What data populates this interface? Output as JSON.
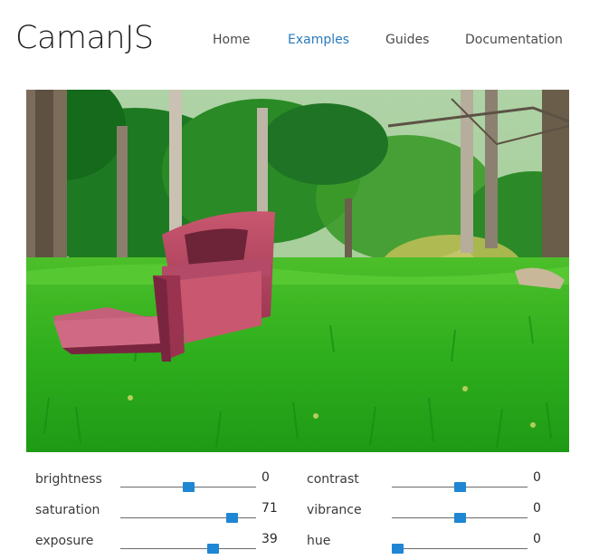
{
  "header": {
    "logo": "CamanJS",
    "nav": [
      {
        "label": "Home",
        "active": false
      },
      {
        "label": "Examples",
        "active": true
      },
      {
        "label": "Guides",
        "active": false
      },
      {
        "label": "Documentation",
        "active": false
      }
    ]
  },
  "colors": {
    "accent": "#2b7bbd",
    "slider_thumb": "#1f86d3"
  },
  "controls": [
    {
      "label": "brightness",
      "value": "0",
      "fraction": 0.5
    },
    {
      "label": "contrast",
      "value": "0",
      "fraction": 0.5
    },
    {
      "label": "saturation",
      "value": "71",
      "fraction": 0.855
    },
    {
      "label": "vibrance",
      "value": "0",
      "fraction": 0.5
    },
    {
      "label": "exposure",
      "value": "39",
      "fraction": 0.7
    },
    {
      "label": "hue",
      "value": "0",
      "fraction": 0.0
    }
  ]
}
